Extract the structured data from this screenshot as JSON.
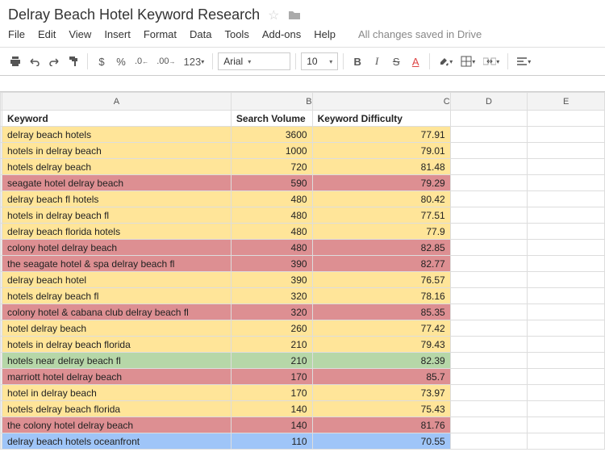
{
  "doc": {
    "title": "Delray Beach Hotel Keyword Research",
    "save_status": "All changes saved in Drive"
  },
  "menu": {
    "file": "File",
    "edit": "Edit",
    "view": "View",
    "insert": "Insert",
    "format": "Format",
    "data": "Data",
    "tools": "Tools",
    "addons": "Add-ons",
    "help": "Help"
  },
  "toolbar": {
    "dollar": "$",
    "percent": "%",
    "dec_dec": ".0",
    "dec_inc": ".00",
    "numfmt": "123",
    "font": "Arial",
    "size": "10",
    "bold": "B",
    "italic": "I",
    "strike": "S",
    "textcolor": "A"
  },
  "cols": {
    "A": "A",
    "B": "B",
    "C": "C",
    "D": "D",
    "E": "E"
  },
  "headers": {
    "keyword": "Keyword",
    "volume": "Search Volume",
    "difficulty": "Keyword Difficulty"
  },
  "chart_data": {
    "type": "table",
    "columns": [
      "Keyword",
      "Search Volume",
      "Keyword Difficulty"
    ],
    "rows": [
      {
        "k": "delray beach hotels",
        "v": "3600",
        "d": "77.91",
        "c": "y"
      },
      {
        "k": "hotels in delray beach",
        "v": "1000",
        "d": "79.01",
        "c": "y"
      },
      {
        "k": "hotels delray beach",
        "v": "720",
        "d": "81.48",
        "c": "y"
      },
      {
        "k": "seagate hotel delray beach",
        "v": "590",
        "d": "79.29",
        "c": "r"
      },
      {
        "k": "delray beach fl hotels",
        "v": "480",
        "d": "80.42",
        "c": "y"
      },
      {
        "k": "hotels in delray beach fl",
        "v": "480",
        "d": "77.51",
        "c": "y"
      },
      {
        "k": "delray beach florida hotels",
        "v": "480",
        "d": "77.9",
        "c": "y"
      },
      {
        "k": "colony hotel delray beach",
        "v": "480",
        "d": "82.85",
        "c": "r"
      },
      {
        "k": "the seagate hotel & spa delray beach fl",
        "v": "390",
        "d": "82.77",
        "c": "r"
      },
      {
        "k": "delray beach hotel",
        "v": "390",
        "d": "76.57",
        "c": "y"
      },
      {
        "k": "hotels delray beach fl",
        "v": "320",
        "d": "78.16",
        "c": "y"
      },
      {
        "k": "colony hotel & cabana club delray beach fl",
        "v": "320",
        "d": "85.35",
        "c": "r"
      },
      {
        "k": "hotel delray beach",
        "v": "260",
        "d": "77.42",
        "c": "y"
      },
      {
        "k": "hotels in delray beach florida",
        "v": "210",
        "d": "79.43",
        "c": "y"
      },
      {
        "k": "hotels near delray beach fl",
        "v": "210",
        "d": "82.39",
        "c": "g"
      },
      {
        "k": "marriott hotel delray beach",
        "v": "170",
        "d": "85.7",
        "c": "r"
      },
      {
        "k": "hotel in delray beach",
        "v": "170",
        "d": "73.97",
        "c": "y"
      },
      {
        "k": "hotels delray beach florida",
        "v": "140",
        "d": "75.43",
        "c": "y"
      },
      {
        "k": "the colony hotel delray beach",
        "v": "140",
        "d": "81.76",
        "c": "r"
      },
      {
        "k": "delray beach hotels oceanfront",
        "v": "110",
        "d": "70.55",
        "c": "b"
      }
    ]
  }
}
